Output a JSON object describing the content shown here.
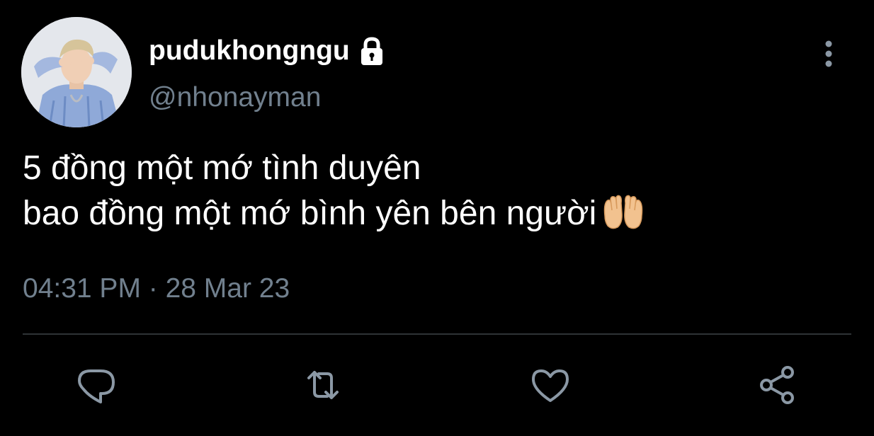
{
  "user": {
    "display_name": "pudukhongngu",
    "handle": "@nhonayman",
    "protected_icon": "lock-icon",
    "avatar": "profile-photo"
  },
  "tweet": {
    "lines": [
      "5 đồng một mớ tình duyên",
      "bao đồng một mớ bình yên bên người"
    ],
    "emoji": "palms-up-together",
    "timestamp": "04:31 PM · 28 Mar 23"
  },
  "menu_icon": "more-vertical-icon",
  "actions": [
    {
      "icon": "reply-icon"
    },
    {
      "icon": "retweet-icon"
    },
    {
      "icon": "like-icon"
    },
    {
      "icon": "share-icon"
    }
  ],
  "colors": {
    "background": "#000000",
    "text_primary": "#ffffff",
    "text_secondary": "#71808e",
    "icon": "#8b98a5",
    "divider": "#2f3336"
  }
}
